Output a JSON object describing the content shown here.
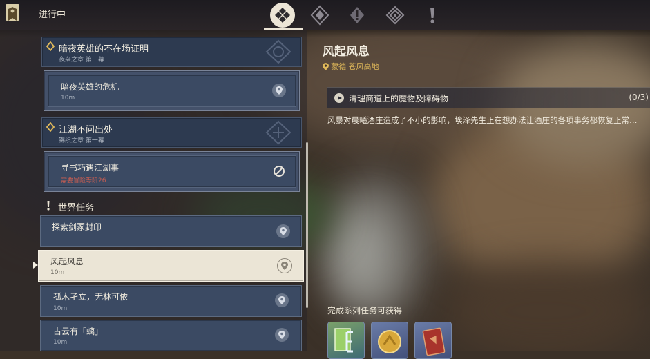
{
  "header": {
    "title": "进行中",
    "tabs": [
      {
        "name": "tab-all",
        "icon": "four-diamond-icon",
        "active": true
      },
      {
        "name": "tab-archon",
        "icon": "archon-quest-icon",
        "active": false
      },
      {
        "name": "tab-story",
        "icon": "story-quest-icon",
        "active": false
      },
      {
        "name": "tab-commission",
        "icon": "commission-icon",
        "active": false
      },
      {
        "name": "tab-world",
        "icon": "world-quest-icon",
        "active": false
      }
    ]
  },
  "quest_list": {
    "groups": [
      {
        "title": "暗夜英雄的不在场证明",
        "chapter": "夜枭之章 第一幕",
        "sub_title": "暗夜英雄的危机",
        "sub_detail": "10m"
      },
      {
        "title": "江湖不问出处",
        "chapter": "锦织之章 第一幕",
        "sub_title": "寻书巧遇江湖事",
        "sub_detail": "需要冒险等阶26"
      }
    ],
    "world_section_label": "世界任务",
    "world_quests": [
      {
        "title": "探索剑冢封印",
        "detail": ""
      },
      {
        "title": "风起风息",
        "detail": "10m"
      },
      {
        "title": "孤木孑立，无林可依",
        "detail": "10m"
      },
      {
        "title": "古云有「螭」",
        "detail": "10m"
      }
    ]
  },
  "detail": {
    "title": "风起风息",
    "location": "蒙德 苍风高地",
    "objective": "清理商道上的魔物及障碍物",
    "objective_count": "(0/3)",
    "description": "风暴对晨曦酒庄造成了不小的影响，埃泽先生正在想办法让酒庄的各项事务都恢复正常…",
    "reward_label": "完成系列任务可获得",
    "rewards": [
      "adventure-exp-icon",
      "mora-coin-icon",
      "red-book-icon"
    ]
  },
  "colors": {
    "accent_gold": "#e0b95a",
    "card_blue": "#3b4a63",
    "selected_cream": "#ebe5d6",
    "warning_red": "#c75d52"
  }
}
